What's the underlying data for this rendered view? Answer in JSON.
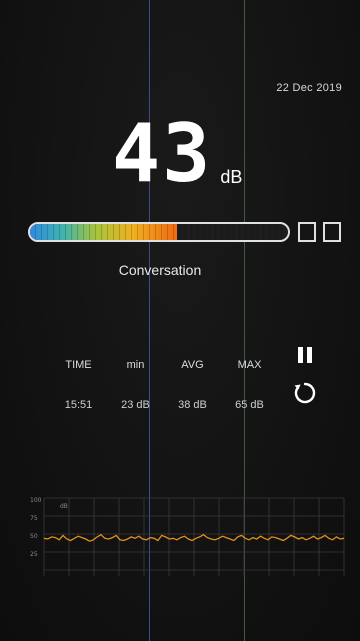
{
  "header": {
    "date": "22 Dec 2019"
  },
  "reading": {
    "value": "43",
    "unit": "dB"
  },
  "meter": {
    "level_fraction": 0.57,
    "colors": [
      "#2f8be0",
      "#3fb3b0",
      "#a8c43a",
      "#f0b020",
      "#f06a12"
    ],
    "extra_boxes": 2
  },
  "category": "Conversation",
  "stats": {
    "headers": [
      "TIME",
      "min",
      "AVG",
      "MAX"
    ],
    "values": [
      "15:51",
      "23 dB",
      "38 dB",
      "65 dB"
    ]
  },
  "controls": {
    "pause_icon": "pause-icon",
    "reset_icon": "reset-icon"
  },
  "graph": {
    "y_ticks": [
      "100",
      "75",
      "50",
      "25"
    ],
    "y_label": "dB",
    "line_color": "#e0901a",
    "y_range": [
      0,
      100
    ],
    "values": [
      44,
      43,
      46,
      45,
      42,
      48,
      43,
      41,
      44,
      47,
      45,
      43,
      40,
      42,
      46,
      49,
      44,
      43,
      45,
      48,
      42,
      41,
      43,
      46,
      44,
      47,
      43,
      42,
      45,
      44,
      41,
      48,
      46,
      43,
      44,
      42,
      45,
      47,
      43,
      41,
      44,
      46,
      49,
      45,
      43,
      42,
      44,
      47,
      45,
      43,
      41,
      46,
      48,
      44,
      42,
      45,
      43,
      47,
      44,
      42,
      46,
      45,
      43,
      41,
      44,
      48,
      46,
      43,
      45,
      42,
      44,
      47,
      43,
      45,
      48,
      44,
      42,
      46,
      43,
      44
    ]
  }
}
